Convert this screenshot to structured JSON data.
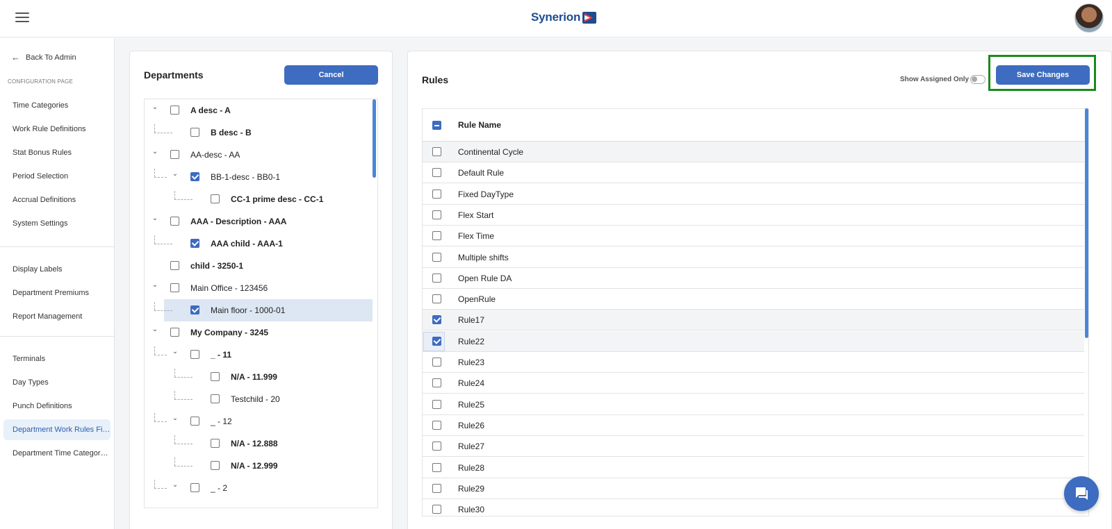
{
  "header": {
    "logo_text": "Synerion",
    "menu_icon": "hamburger-menu-icon",
    "avatar_icon": "user-avatar"
  },
  "sidebar": {
    "back_label": "Back To Admin",
    "section_label": "CONFIGURATION PAGE",
    "group1": [
      "Time Categories",
      "Work Rule Definitions",
      "Stat Bonus Rules",
      "Period Selection",
      "Accrual Definitions",
      "System Settings"
    ],
    "group2": [
      "Display Labels",
      "Department Premiums",
      "Report Management"
    ],
    "group3": [
      "Terminals",
      "Day Types",
      "Punch Definitions",
      "Department Work Rules Filt...",
      "Department Time Category ..."
    ],
    "active_item": "Department Work Rules Filt..."
  },
  "departments": {
    "title": "Departments",
    "cancel_label": "Cancel",
    "tree": [
      {
        "label": "A desc - A",
        "bold": true,
        "checked": false,
        "expanded": true
      },
      {
        "label": "B desc - B",
        "bold": true,
        "checked": false
      },
      {
        "label": "AA-desc - AA",
        "bold": false,
        "checked": false,
        "expanded": true
      },
      {
        "label": "BB-1-desc - BB0-1",
        "bold": false,
        "checked": true,
        "expanded": true
      },
      {
        "label": "CC-1 prime desc - CC-1",
        "bold": true,
        "checked": false
      },
      {
        "label": "AAA - Description - AAA",
        "bold": true,
        "checked": false,
        "expanded": true
      },
      {
        "label": "AAA child - AAA-1",
        "bold": true,
        "checked": true
      },
      {
        "label": "child - 3250-1",
        "bold": true,
        "checked": false
      },
      {
        "label": "Main Office - 123456",
        "bold": false,
        "checked": false,
        "expanded": true
      },
      {
        "label": "Main floor - 1000-01",
        "bold": false,
        "checked": true,
        "selected": true
      },
      {
        "label": "My Company - 3245",
        "bold": true,
        "checked": false,
        "expanded": true
      },
      {
        "label": "_ - 11",
        "bold": true,
        "checked": false,
        "expanded": true
      },
      {
        "label": "N/A - 11.999",
        "bold": true,
        "checked": false
      },
      {
        "label": "Testchild - 20",
        "bold": false,
        "checked": false
      },
      {
        "label": "_ - 12",
        "bold": false,
        "checked": false,
        "expanded": true
      },
      {
        "label": "N/A - 12.888",
        "bold": true,
        "checked": false
      },
      {
        "label": "N/A - 12.999",
        "bold": true,
        "checked": false
      },
      {
        "label": "_ - 2",
        "bold": false,
        "checked": false,
        "expanded": true
      }
    ]
  },
  "rules": {
    "title": "Rules",
    "show_assigned_label": "Show Assigned Only",
    "show_assigned_on": false,
    "save_label": "Save Changes",
    "column_header": "Rule Name",
    "header_checkbox_state": "indeterminate",
    "rows": [
      {
        "name": "Continental Cycle",
        "checked": false
      },
      {
        "name": "Default Rule",
        "checked": false
      },
      {
        "name": "Fixed DayType",
        "checked": false
      },
      {
        "name": "Flex Start",
        "checked": false
      },
      {
        "name": "Flex Time",
        "checked": false
      },
      {
        "name": "Multiple shifts",
        "checked": false
      },
      {
        "name": "Open Rule DA",
        "checked": false
      },
      {
        "name": "OpenRule",
        "checked": false
      },
      {
        "name": "Rule17",
        "checked": true
      },
      {
        "name": "Rule22",
        "checked": true
      },
      {
        "name": "Rule23",
        "checked": false
      },
      {
        "name": "Rule24",
        "checked": false
      },
      {
        "name": "Rule25",
        "checked": false
      },
      {
        "name": "Rule26",
        "checked": false
      },
      {
        "name": "Rule27",
        "checked": false
      },
      {
        "name": "Rule28",
        "checked": false
      },
      {
        "name": "Rule29",
        "checked": false
      },
      {
        "name": "Rule30",
        "checked": false
      }
    ]
  },
  "colors": {
    "primary": "#3d6cc0",
    "highlight_border": "#1b8a1b",
    "logo": "#1e4c8f"
  },
  "chat_icon": "chat-bubble-icon"
}
